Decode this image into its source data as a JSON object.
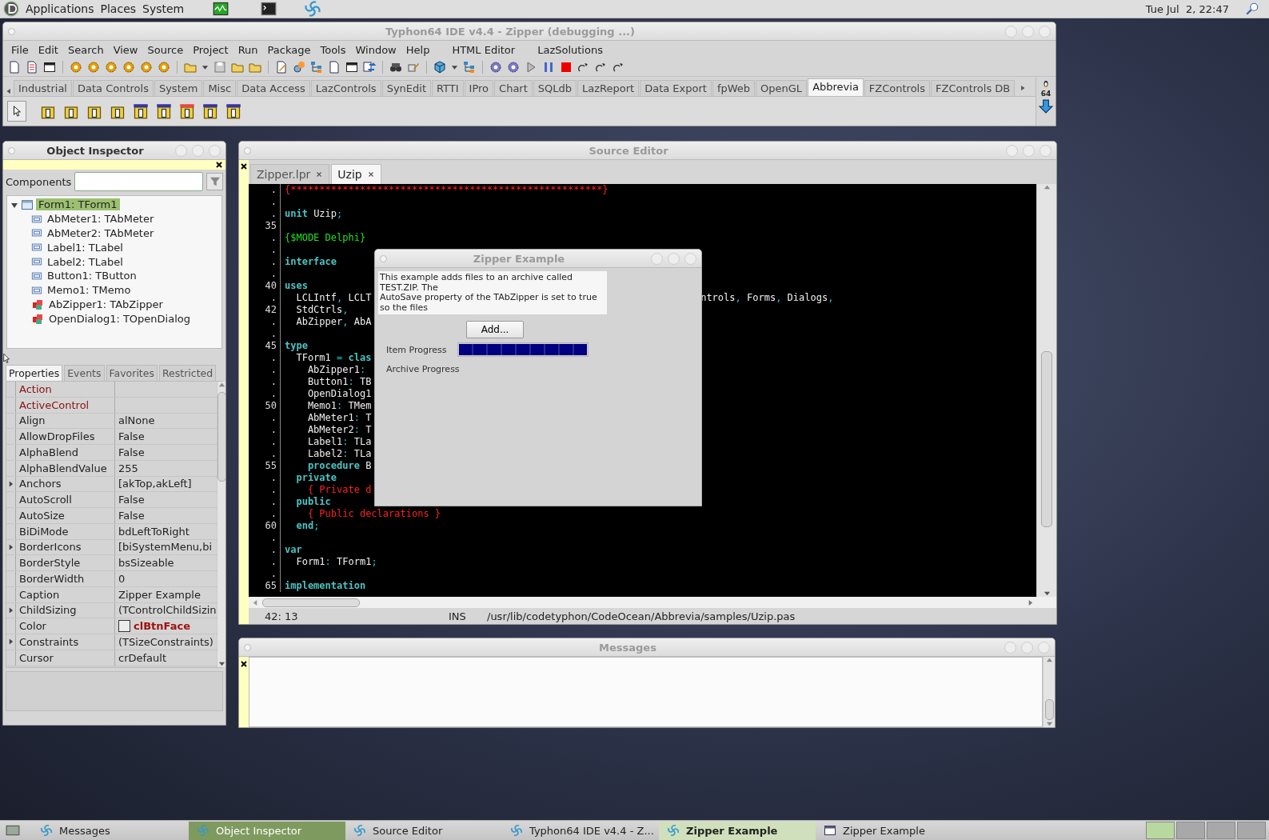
{
  "top_panel": {
    "menus": [
      "Applications",
      "Places",
      "System"
    ],
    "clock": "Tue Jul  2, 22:47"
  },
  "ide": {
    "title": "Typhon64 IDE v4.4 - Zipper (debugging ...)",
    "active": false,
    "menu": [
      "File",
      "Edit",
      "Search",
      "View",
      "Source",
      "Project",
      "Run",
      "Package",
      "Tools",
      "Window",
      "Help",
      "HTML Editor",
      "LazSolutions"
    ],
    "palette_tabs": [
      {
        "label": "Industrial",
        "selected": false
      },
      {
        "label": "Data Controls",
        "selected": false
      },
      {
        "label": "System",
        "selected": false
      },
      {
        "label": "Misc",
        "selected": false
      },
      {
        "label": "Data Access",
        "selected": false
      },
      {
        "label": "LazControls",
        "selected": false
      },
      {
        "label": "SynEdit",
        "selected": false
      },
      {
        "label": "RTTI",
        "selected": false
      },
      {
        "label": "IPro",
        "selected": false
      },
      {
        "label": "Chart",
        "selected": false
      },
      {
        "label": "SQLdb",
        "selected": false
      },
      {
        "label": "LazReport",
        "selected": false
      },
      {
        "label": "Data Export",
        "selected": false
      },
      {
        "label": "fpWeb",
        "selected": false
      },
      {
        "label": "OpenGL",
        "selected": false
      },
      {
        "label": "Abbrevia",
        "selected": true
      },
      {
        "label": "FZControls",
        "selected": false
      },
      {
        "label": "FZControls DB",
        "selected": false
      }
    ],
    "palette_badge": "64"
  },
  "object_inspector": {
    "title": "Object Inspector",
    "active": true,
    "components_label": "Components",
    "tree": {
      "label": "Form1: TForm1",
      "selected": true,
      "expanded": true,
      "children": [
        {
          "label": "AbMeter1: TAbMeter",
          "kind": "control",
          "selected": false
        },
        {
          "label": "AbMeter2: TAbMeter",
          "kind": "control",
          "selected": false
        },
        {
          "label": "Label1: TLabel",
          "kind": "control",
          "selected": false
        },
        {
          "label": "Label2: TLabel",
          "kind": "control",
          "selected": false
        },
        {
          "label": "Button1: TButton",
          "kind": "control",
          "selected": false
        },
        {
          "label": "Memo1: TMemo",
          "kind": "control",
          "selected": false
        },
        {
          "label": "AbZipper1: TAbZipper",
          "kind": "component",
          "selected": false
        },
        {
          "label": "OpenDialog1: TOpenDialog",
          "kind": "component",
          "selected": false
        }
      ]
    },
    "tabs": [
      {
        "label": "Properties",
        "selected": true
      },
      {
        "label": "Events",
        "selected": false
      },
      {
        "label": "Favorites",
        "selected": false
      },
      {
        "label": "Restricted",
        "selected": false
      }
    ],
    "properties": [
      {
        "name": "Action",
        "kind": "reference",
        "expandable": false
      },
      {
        "name": "ActiveControl",
        "kind": "reference",
        "expandable": false
      },
      {
        "name": "Align",
        "value": "alNone",
        "kind": "plain",
        "expandable": false
      },
      {
        "name": "AllowDropFiles",
        "value": "False",
        "kind": "plain",
        "expandable": false
      },
      {
        "name": "AlphaBlend",
        "value": "False",
        "kind": "plain",
        "expandable": false
      },
      {
        "name": "AlphaBlendValue",
        "value": "255",
        "kind": "plain",
        "expandable": false
      },
      {
        "name": "Anchors",
        "value": "[akTop,akLeft]",
        "kind": "plain",
        "expandable": true
      },
      {
        "name": "AutoScroll",
        "value": "False",
        "kind": "plain",
        "expandable": false
      },
      {
        "name": "AutoSize",
        "value": "False",
        "kind": "plain",
        "expandable": false
      },
      {
        "name": "BiDiMode",
        "value": "bdLeftToRight",
        "kind": "plain",
        "expandable": false
      },
      {
        "name": "BorderIcons",
        "value": "[biSystemMenu,bi",
        "kind": "plain",
        "expandable": true
      },
      {
        "name": "BorderStyle",
        "value": "bsSizeable",
        "kind": "plain",
        "expandable": false
      },
      {
        "name": "BorderWidth",
        "value": "0",
        "kind": "plain",
        "expandable": false
      },
      {
        "name": "Caption",
        "value": "Zipper Example",
        "kind": "plain",
        "expandable": false
      },
      {
        "name": "ChildSizing",
        "value": "(TControlChildSizin",
        "kind": "plain",
        "expandable": true
      },
      {
        "name": "Color",
        "value": "clBtnFace",
        "kind": "color",
        "expandable": false
      },
      {
        "name": "Constraints",
        "value": "(TSizeConstraints)",
        "kind": "plain",
        "expandable": true
      },
      {
        "name": "Cursor",
        "value": "crDefault",
        "kind": "plain",
        "expandable": false
      }
    ]
  },
  "source_editor": {
    "title": "Source Editor",
    "active": false,
    "tabs": [
      {
        "label": "Zipper.lpr",
        "selected": false
      },
      {
        "label": "Uzip",
        "selected": true
      }
    ],
    "lines": [
      {
        "gutter": ".",
        "segments": [
          {
            "text": "{******************************************************}",
            "kind": "comment"
          }
        ]
      },
      {
        "gutter": "."
      },
      {
        "gutter": ".",
        "segments": [
          {
            "text": "unit",
            "kind": "keyword"
          },
          {
            "text": " Uzip",
            "kind": "ident"
          },
          {
            "text": ";",
            "kind": "symbol"
          }
        ]
      },
      {
        "gutter": "35"
      },
      {
        "gutter": ".",
        "segments": [
          {
            "text": "{$MODE Delphi}",
            "kind": "directive"
          }
        ]
      },
      {
        "gutter": "."
      },
      {
        "gutter": ".",
        "segments": [
          {
            "text": "interface",
            "kind": "keyword"
          }
        ]
      },
      {
        "gutter": "."
      },
      {
        "gutter": "40",
        "segments": [
          {
            "text": "uses",
            "kind": "keyword"
          }
        ]
      },
      {
        "gutter": ".",
        "segments": [
          {
            "text": "  LCLIntf",
            "kind": "ident"
          },
          {
            "text": ",",
            "kind": "symbol"
          },
          {
            "text": " LCLT",
            "kind": "ident"
          }
        ],
        "resumed": [
          {
            "text": "ntrols",
            "kind": "ident"
          },
          {
            "text": ",",
            "kind": "symbol"
          },
          {
            "text": " Forms",
            "kind": "ident"
          },
          {
            "text": ",",
            "kind": "symbol"
          },
          {
            "text": " Dialogs",
            "kind": "ident"
          },
          {
            "text": ",",
            "kind": "symbol"
          }
        ]
      },
      {
        "gutter": "42",
        "segments": [
          {
            "text": "  StdCtrls",
            "kind": "ident"
          },
          {
            "text": ",",
            "kind": "symbol"
          }
        ]
      },
      {
        "gutter": ".",
        "segments": [
          {
            "text": "  AbZipper",
            "kind": "ident"
          },
          {
            "text": ",",
            "kind": "symbol"
          },
          {
            "text": " AbA",
            "kind": "ident"
          }
        ]
      },
      {
        "gutter": "."
      },
      {
        "gutter": "45",
        "segments": [
          {
            "text": "type",
            "kind": "keyword"
          }
        ]
      },
      {
        "gutter": ".",
        "segments": [
          {
            "text": "  TForm1 ",
            "kind": "ident"
          },
          {
            "text": "=",
            "kind": "symbol"
          },
          {
            "text": " clas",
            "kind": "keyword"
          }
        ]
      },
      {
        "gutter": ".",
        "segments": [
          {
            "text": "    AbZipper1",
            "kind": "ident"
          },
          {
            "text": ":",
            "kind": "symbol"
          }
        ]
      },
      {
        "gutter": ".",
        "segments": [
          {
            "text": "    Button1",
            "kind": "ident"
          },
          {
            "text": ":",
            "kind": "symbol"
          },
          {
            "text": " TB",
            "kind": "ident"
          }
        ]
      },
      {
        "gutter": ".",
        "segments": [
          {
            "text": "    OpenDialog1",
            "kind": "ident"
          }
        ]
      },
      {
        "gutter": "50",
        "segments": [
          {
            "text": "    Memo1",
            "kind": "ident"
          },
          {
            "text": ":",
            "kind": "symbol"
          },
          {
            "text": " TMem",
            "kind": "ident"
          }
        ]
      },
      {
        "gutter": ".",
        "segments": [
          {
            "text": "    AbMeter1",
            "kind": "ident"
          },
          {
            "text": ":",
            "kind": "symbol"
          },
          {
            "text": " T",
            "kind": "ident"
          }
        ]
      },
      {
        "gutter": ".",
        "segments": [
          {
            "text": "    AbMeter2",
            "kind": "ident"
          },
          {
            "text": ":",
            "kind": "symbol"
          },
          {
            "text": " T",
            "kind": "ident"
          }
        ]
      },
      {
        "gutter": ".",
        "segments": [
          {
            "text": "    Label1",
            "kind": "ident"
          },
          {
            "text": ":",
            "kind": "symbol"
          },
          {
            "text": " TLa",
            "kind": "ident"
          }
        ]
      },
      {
        "gutter": ".",
        "segments": [
          {
            "text": "    Label2",
            "kind": "ident"
          },
          {
            "text": ":",
            "kind": "symbol"
          },
          {
            "text": " TLa",
            "kind": "ident"
          }
        ]
      },
      {
        "gutter": "55",
        "segments": [
          {
            "text": "    procedure",
            "kind": "keyword"
          },
          {
            "text": " B",
            "kind": "ident"
          }
        ]
      },
      {
        "gutter": ".",
        "segments": [
          {
            "text": "  private",
            "kind": "keyword"
          }
        ]
      },
      {
        "gutter": ".",
        "segments": [
          {
            "text": "    { Private d",
            "kind": "comment"
          }
        ]
      },
      {
        "gutter": ".",
        "segments": [
          {
            "text": "  public",
            "kind": "keyword"
          }
        ]
      },
      {
        "gutter": ".",
        "segments": [
          {
            "text": "    { Public declarations }",
            "kind": "comment"
          }
        ]
      },
      {
        "gutter": "60",
        "segments": [
          {
            "text": "  end",
            "kind": "keyword"
          },
          {
            "text": ";",
            "kind": "symbol"
          }
        ]
      },
      {
        "gutter": "."
      },
      {
        "gutter": ".",
        "segments": [
          {
            "text": "var",
            "kind": "keyword"
          }
        ]
      },
      {
        "gutter": ".",
        "segments": [
          {
            "text": "  Form1",
            "kind": "ident"
          },
          {
            "text": ":",
            "kind": "symbol"
          },
          {
            "text": " TForm1",
            "kind": "ident"
          },
          {
            "text": ";",
            "kind": "symbol"
          }
        ]
      },
      {
        "gutter": "."
      },
      {
        "gutter": "65",
        "segments": [
          {
            "text": "implementation",
            "kind": "keyword"
          }
        ]
      }
    ],
    "status": {
      "position": "42: 13",
      "mode": "INS",
      "file": "/usr/lib/codetyphon/CodeOcean/Abbrevia/samples/Uzip.pas"
    }
  },
  "dialog": {
    "title": "Zipper Example",
    "active": false,
    "memo": [
      "This example adds files to an archive called",
      "TEST.ZIP. The",
      "AutoSave property of the TAbZipper is set to true",
      "so the files"
    ],
    "button": "Add...",
    "progress": [
      {
        "label": "Item Progress",
        "level": 1
      },
      {
        "label": "Archive Progress",
        "level": 0
      }
    ]
  },
  "messages": {
    "title": "Messages",
    "active": false
  },
  "taskbar": [
    {
      "label": "Messages",
      "kind": "ide",
      "selected": false,
      "highlighted": false
    },
    {
      "label": "Object Inspector",
      "kind": "ide",
      "selected": false,
      "highlighted": true
    },
    {
      "label": "Source Editor",
      "kind": "ide",
      "selected": false,
      "highlighted": false
    },
    {
      "label": "Typhon64 IDE v4.4 - Z...",
      "kind": "ide",
      "selected": false,
      "highlighted": false
    },
    {
      "label": "Zipper Example",
      "kind": "ide",
      "selected": true,
      "highlighted": false
    },
    {
      "label": "Zipper Example",
      "kind": "form",
      "selected": false,
      "highlighted": false
    }
  ]
}
